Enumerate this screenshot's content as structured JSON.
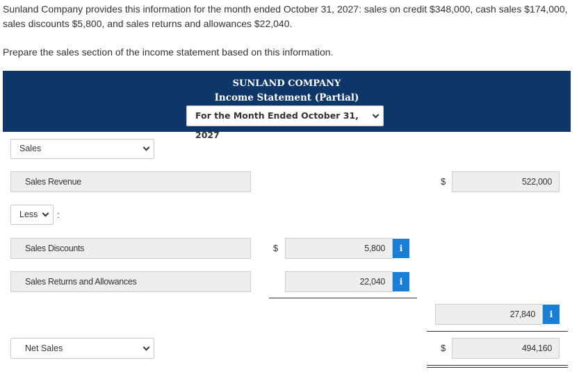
{
  "problem": {
    "intro": "Sunland Company provides this information for the month ended October 31, 2027: sales on credit $348,000, cash sales $174,000, sales discounts $5,800, and sales returns and allowances $22,040.",
    "prompt": "Prepare the sales section of the income statement based on this information."
  },
  "header": {
    "company": "SUNLAND COMPANY",
    "statement": "Income Statement (Partial)",
    "period": "For the Month Ended October 31, 2027"
  },
  "rows": {
    "sales_select": "Sales",
    "sales_revenue": {
      "label": "Sales Revenue",
      "currency": "$",
      "amount": "522,000"
    },
    "less_select": "Less",
    "less_colon": ":",
    "sales_discounts": {
      "label": "Sales Discounts",
      "currency": "$",
      "amount": "5,800"
    },
    "returns": {
      "label": "Sales Returns and Allowances",
      "amount": "22,040"
    },
    "deductions_total": "27,840",
    "net_sales": {
      "label": "Net Sales",
      "currency": "$",
      "amount": "494,160"
    }
  },
  "icons": {
    "info": "i"
  },
  "colors": {
    "header_bg": "#0f3668",
    "info_bg": "#1a7fd4",
    "field_bg": "#eeeeee"
  }
}
